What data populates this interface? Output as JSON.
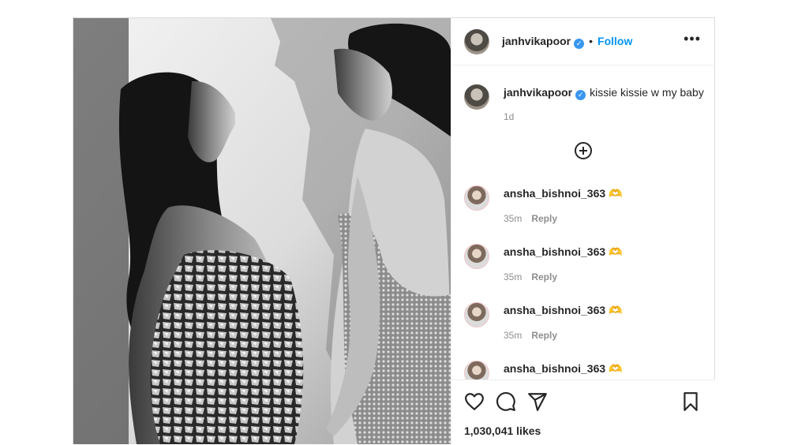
{
  "post": {
    "author": {
      "username": "janhvikapoor",
      "verified": true,
      "verified_glyph": "✓"
    },
    "header": {
      "separator": "•",
      "follow_label": "Follow",
      "more_label": "•••"
    },
    "caption": {
      "username": "janhvikapoor",
      "text": "kissie kissie w my baby",
      "time": "1d"
    },
    "comments": [
      {
        "username": "ansha_bishnoi_363 🫶",
        "time": "35m",
        "reply_label": "Reply"
      },
      {
        "username": "ansha_bishnoi_363 🫶",
        "time": "35m",
        "reply_label": "Reply"
      },
      {
        "username": "ansha_bishnoi_363 🫶",
        "time": "35m",
        "reply_label": "Reply"
      },
      {
        "username": "ansha_bishnoi_363 🫶",
        "time": "",
        "reply_label": ""
      }
    ],
    "actions": {
      "icons": [
        "heart-icon",
        "comment-icon",
        "share-icon",
        "bookmark-icon"
      ]
    },
    "likes": "1,030,041 likes"
  },
  "colors": {
    "accent": "#0095f6",
    "text": "#262626",
    "muted": "#8e8e8e",
    "border": "#dbdbdb"
  }
}
